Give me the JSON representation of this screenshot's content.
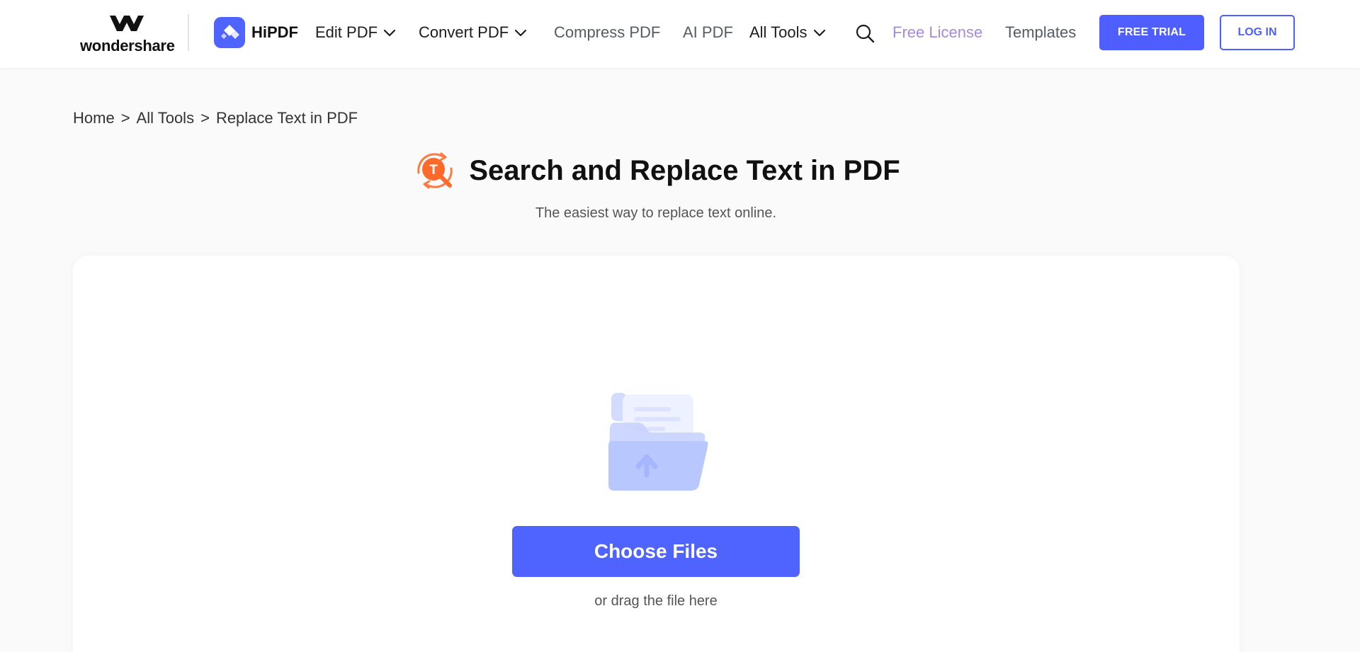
{
  "header": {
    "brand": {
      "name": "wondershare"
    },
    "product": {
      "name": "HiPDF"
    },
    "nav": {
      "edit_pdf": "Edit PDF",
      "convert_pdf": "Convert PDF",
      "compress_pdf": "Compress PDF",
      "ai_pdf": "AI PDF",
      "all_tools": "All Tools",
      "free_license": "Free License",
      "templates": "Templates"
    },
    "free_trial_label": "FREE TRIAL",
    "login_label": "LOG IN"
  },
  "breadcrumb": [
    {
      "label": "Home"
    },
    {
      "label": "All Tools"
    },
    {
      "label": "Replace Text in PDF"
    }
  ],
  "breadcrumb_separator": ">",
  "main": {
    "title": "Search and Replace Text in PDF",
    "title_icon_letter": "T",
    "subtitle": "The easiest way to replace text online.",
    "upload": {
      "choose_label": "Choose Files",
      "drag_hint": "or drag the file here"
    }
  },
  "icons": {
    "brand_mark": "wondershare-logo-icon",
    "hipdf": "hipdf-logo-icon",
    "chevron": "chevron-down-icon",
    "search": "search-icon",
    "title": "replace-text-icon",
    "upload": "folder-upload-icon"
  },
  "colors": {
    "accent": "#4f5eff",
    "free_license": "#a58bd9",
    "title_icon": "#ff6a2b",
    "background": "#fafafa",
    "card": "#ffffff"
  }
}
